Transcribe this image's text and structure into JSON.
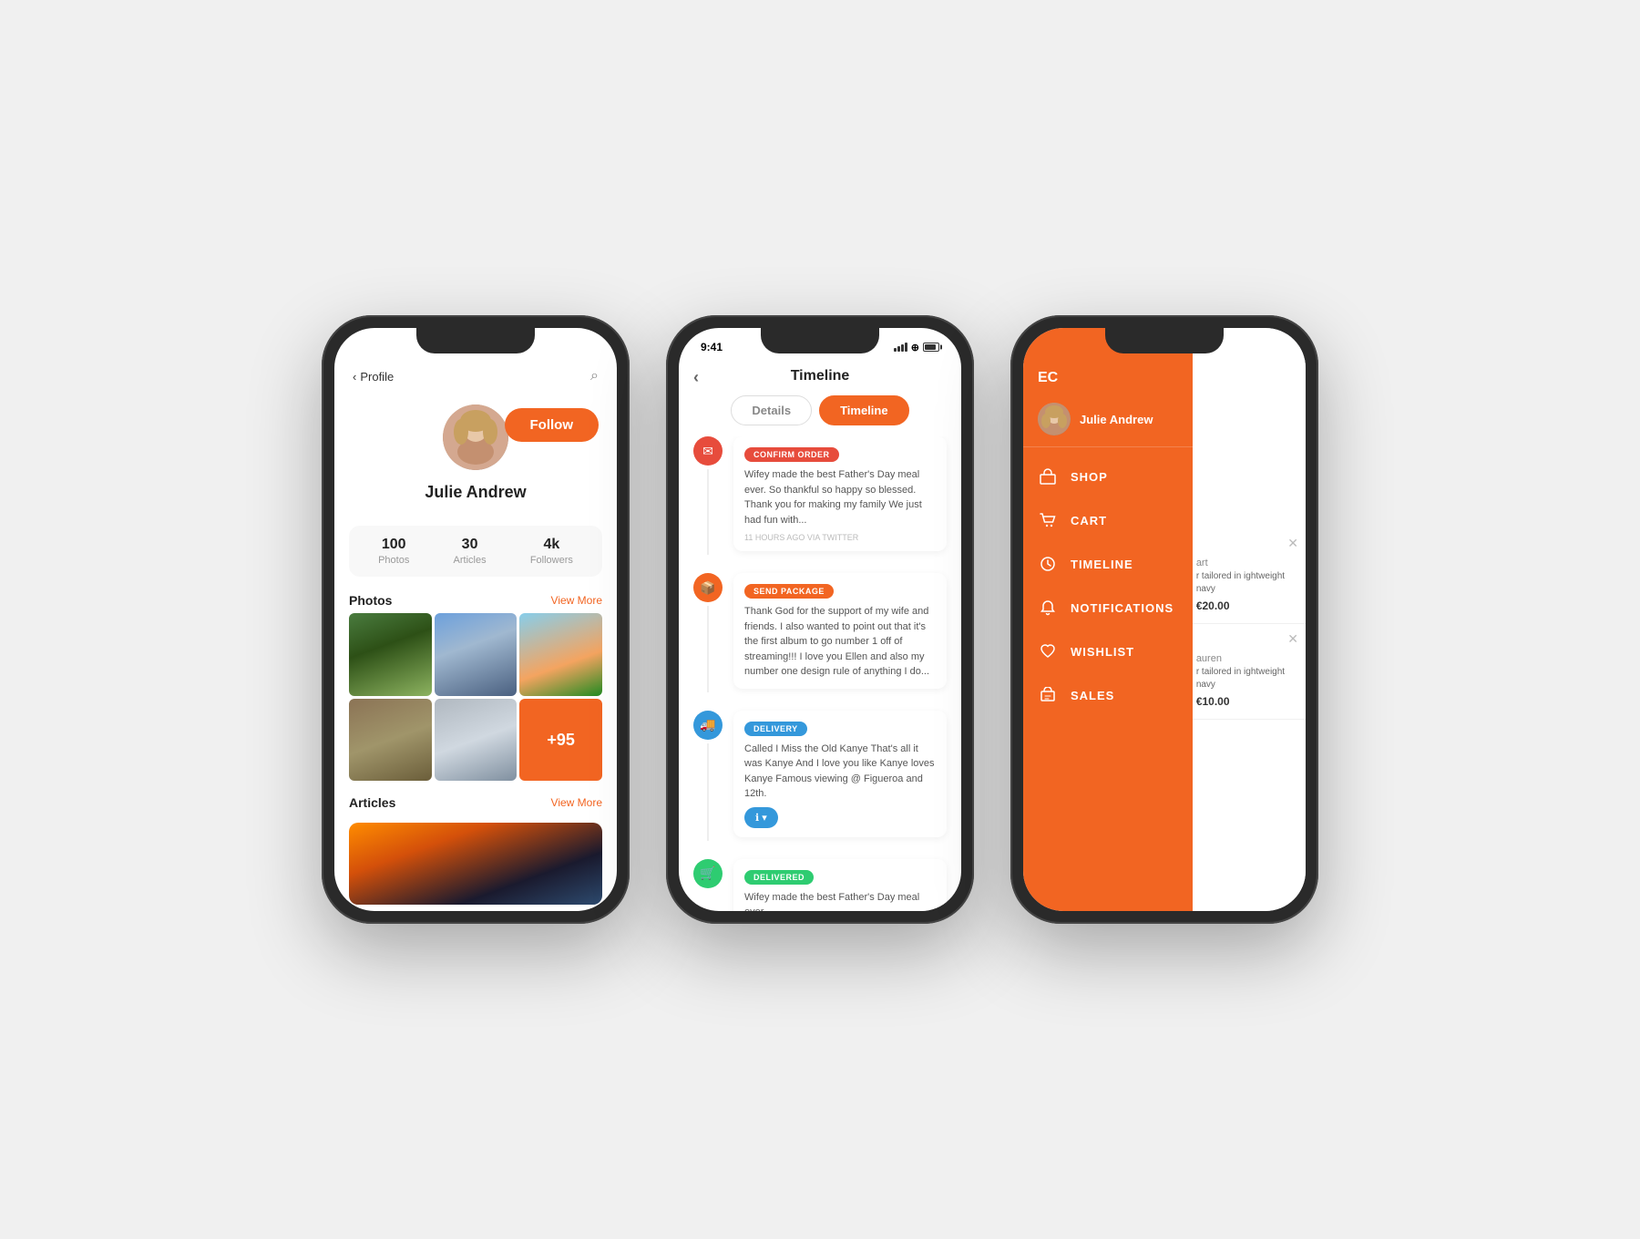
{
  "background": "#f0f0f0",
  "accentColor": "#f26522",
  "phones": {
    "phone1": {
      "title": "Profile",
      "follow_label": "Follow",
      "user_name": "Julie Andrew",
      "stats": [
        {
          "num": "100",
          "label": "Photos"
        },
        {
          "num": "30",
          "label": "Articles"
        },
        {
          "num": "4k",
          "label": "Followers"
        }
      ],
      "photos_section": "Photos",
      "view_more": "View More",
      "articles_section": "Articles",
      "photo_more_count": "+95"
    },
    "phone2": {
      "status_time": "9:41",
      "title": "Timeline",
      "tab_details": "Details",
      "tab_timeline": "Timeline",
      "events": [
        {
          "badge": "CONFIRM ORDER",
          "badge_class": "badge-red",
          "dot_class": "red",
          "text": "Wifey made the best Father's Day meal ever. So thankful so happy so blessed. Thank you for making my family We just had fun with...",
          "time": "11 HOURS AGO VIA TWITTER"
        },
        {
          "badge": "SEND PACKAGE",
          "badge_class": "badge-orange",
          "dot_class": "orange",
          "text": "Thank God for the support of my wife and friends. I also wanted to point out that it's the first album to go number 1 off of streaming!!! I love you Ellen and also my number one design rule of anything I do...",
          "time": ""
        },
        {
          "badge": "DELIVERY",
          "badge_class": "badge-blue",
          "dot_class": "blue",
          "text": "Called I Miss the Old Kanye That's all it was Kanye And I love you like Kanye loves Kanye Famous viewing @ Figueroa and 12th.",
          "time": ""
        },
        {
          "badge": "DELIVERED",
          "badge_class": "badge-green",
          "dot_class": "green",
          "text": "Wifey made the best Father's Day meal ever.",
          "time": ""
        }
      ]
    },
    "phone3": {
      "logo": "EC",
      "user_name": "Julie Andrew",
      "menu_items": [
        {
          "label": "SHOP",
          "icon": "🏠"
        },
        {
          "label": "CART",
          "icon": "🛒"
        },
        {
          "label": "TIMELINE",
          "icon": "⏱"
        },
        {
          "label": "NOTIFICATIONS",
          "icon": "🔔"
        },
        {
          "label": "WISHLIST",
          "icon": "♥"
        },
        {
          "label": "SALES",
          "icon": "🎁"
        }
      ],
      "cards": [
        {
          "text": "r tailored in\nightweight navy",
          "name": "auren",
          "price": "€20.00"
        },
        {
          "text": "r tailored in\nightweight navy",
          "name": "art",
          "price": "€10.00"
        }
      ]
    }
  }
}
